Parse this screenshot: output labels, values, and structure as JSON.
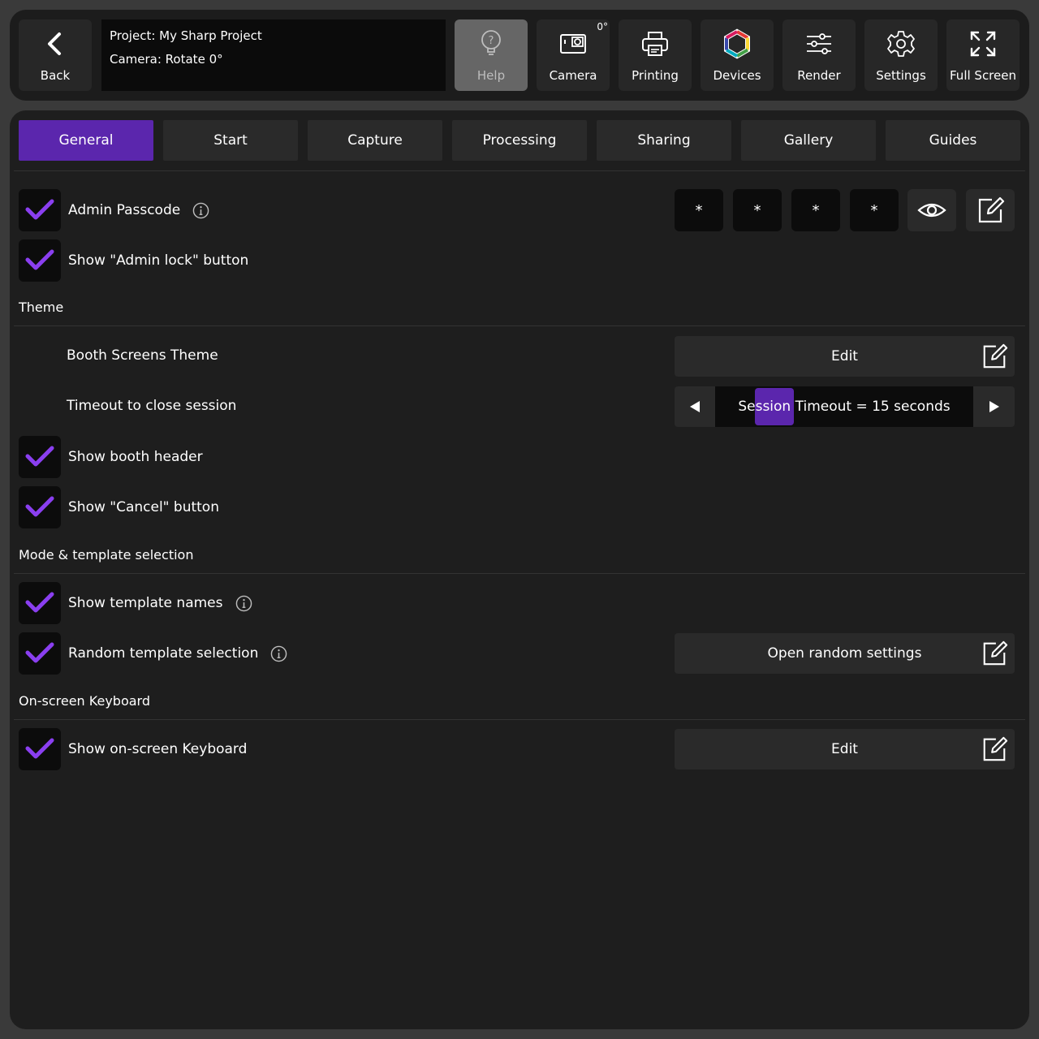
{
  "topbar": {
    "back_label": "Back",
    "project_line": "Project: My Sharp Project",
    "camera_line": "Camera: Rotate 0°",
    "help_label": "Help",
    "camera_label": "Camera",
    "camera_rotation": "0°",
    "printing_label": "Printing",
    "devices_label": "Devices",
    "render_label": "Render",
    "settings_label": "Settings",
    "fullscreen_label": "Full Screen"
  },
  "tabs": [
    {
      "label": "General",
      "active": true
    },
    {
      "label": "Start"
    },
    {
      "label": "Capture"
    },
    {
      "label": "Processing"
    },
    {
      "label": "Sharing"
    },
    {
      "label": "Gallery"
    },
    {
      "label": "Guides"
    }
  ],
  "general": {
    "admin_passcode": {
      "label": "Admin Passcode",
      "checked": true,
      "digits": [
        "*",
        "*",
        "*",
        "*"
      ]
    },
    "admin_lock": {
      "label": "Show \"Admin lock\" button",
      "checked": true
    },
    "theme_section": "Theme",
    "booth_theme": {
      "label": "Booth Screens Theme",
      "button": "Edit"
    },
    "timeout": {
      "label": "Timeout to close session",
      "value": "Session Timeout = 15 seconds"
    },
    "booth_header": {
      "label": "Show booth header",
      "checked": true
    },
    "cancel_button": {
      "label": "Show \"Cancel\" button",
      "checked": true
    },
    "mode_section": "Mode & template selection",
    "template_names": {
      "label": "Show template names",
      "checked": true
    },
    "random_template": {
      "label": "Random template selection",
      "checked": true,
      "button": "Open random settings"
    },
    "keyboard_section": "On-screen Keyboard",
    "keyboard": {
      "label": "Show on-screen Keyboard",
      "checked": true,
      "button": "Edit"
    }
  },
  "colors": {
    "accent": "#5b26ad",
    "check": "#8a3ff0",
    "background": "#1e1e1e"
  }
}
